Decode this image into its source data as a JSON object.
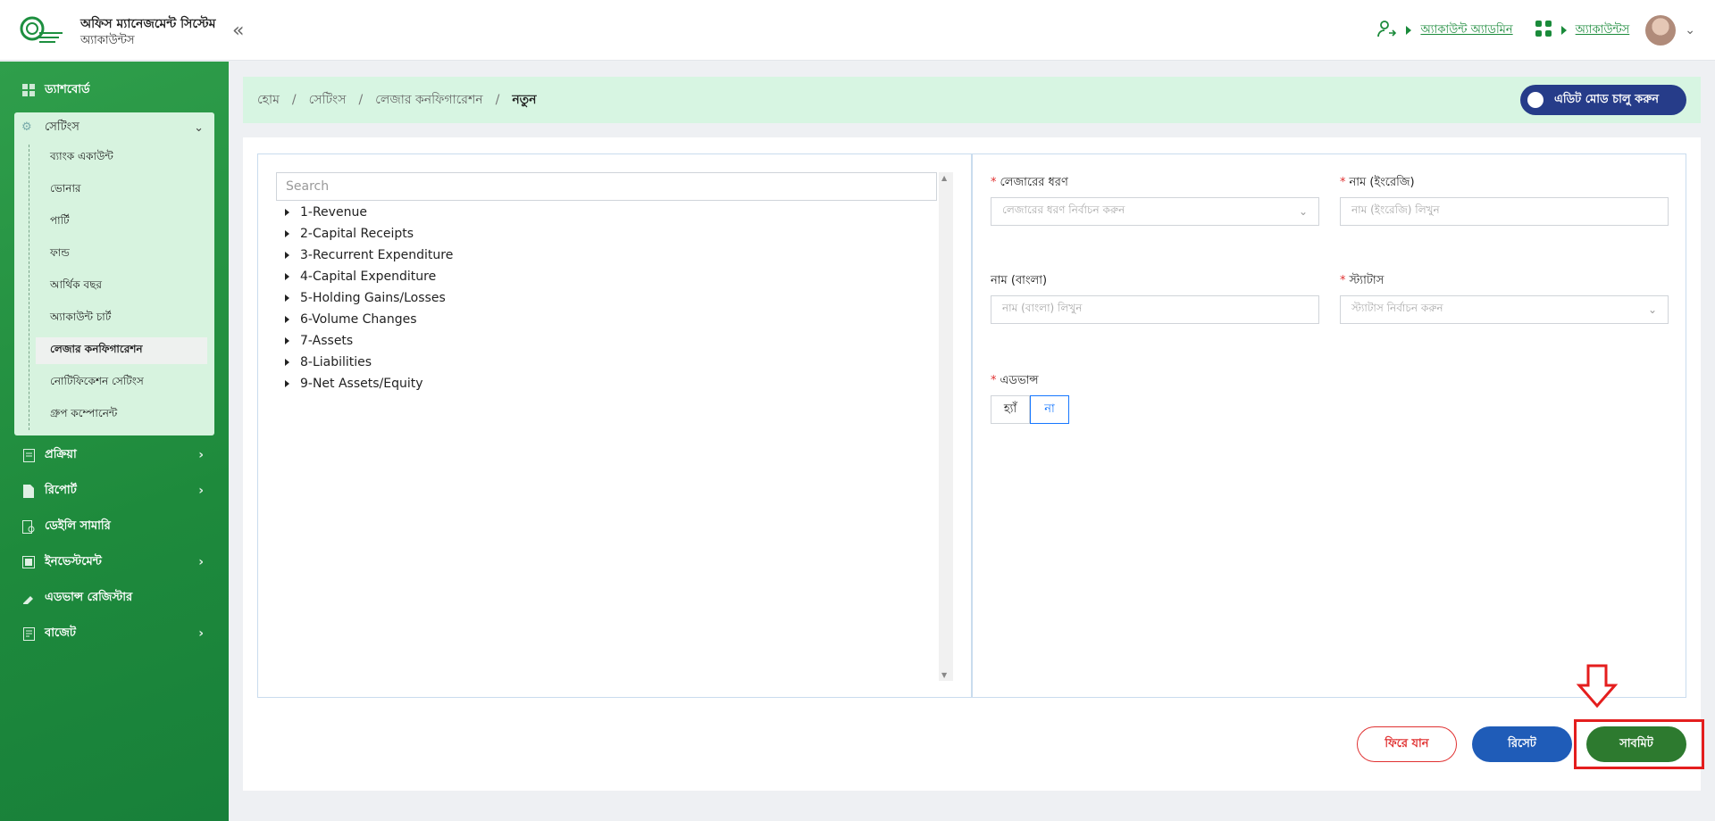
{
  "header": {
    "app_title": "অফিস ম্যানেজমেন্ট সিস্টেম",
    "app_subtitle": "অ্যাকাউন্টস",
    "collapse_icon": "«",
    "admin_link": "অ্যাকাউন্ট অ্যাডমিন",
    "module_link": "অ্যাকাউন্টস",
    "accent_color": "#1a8a3a"
  },
  "sidebar": {
    "dashboard": "ড্যাশবোর্ড",
    "settings": "সেটিংস",
    "settings_items": [
      {
        "label": "ব্যাংক একাউন্ট"
      },
      {
        "label": "ভোনার"
      },
      {
        "label": "পার্টি"
      },
      {
        "label": "ফান্ড"
      },
      {
        "label": "আর্থিক বছর"
      },
      {
        "label": "অ্যাকাউন্ট চার্ট"
      },
      {
        "label": "লেজার কনফিগারেশন"
      },
      {
        "label": "নোটিফিকেশন সেটিংস"
      },
      {
        "label": "গ্রুপ কম্পোনেন্ট"
      }
    ],
    "process": "প্রক্রিয়া",
    "report": "রিপোর্ট",
    "daily_summary": "ডেইলি সামারি",
    "investment": "ইনভেস্টমেন্ট",
    "advance_register": "এডভান্স রেজিস্টার",
    "budget": "বাজেট"
  },
  "breadcrumb": {
    "items": [
      "হোম",
      "সেটিংস",
      "লেজার কনফিগারেশন",
      "নতুন"
    ]
  },
  "edit_mode_label": "এডিট মোড চালু করুন",
  "tree": {
    "search_placeholder": "Search",
    "nodes": [
      {
        "label": "1-Revenue"
      },
      {
        "label": "2-Capital Receipts"
      },
      {
        "label": "3-Recurrent Expenditure"
      },
      {
        "label": "4-Capital Expenditure"
      },
      {
        "label": "5-Holding Gains/Losses"
      },
      {
        "label": "6-Volume Changes"
      },
      {
        "label": "7-Assets"
      },
      {
        "label": "8-Liabilities"
      },
      {
        "label": "9-Net Assets/Equity"
      }
    ]
  },
  "form": {
    "ledger_type_label": "লেজারের ধরণ",
    "ledger_type_placeholder": "লেজারের ধরণ নির্বাচন করুন",
    "name_en_label": "নাম (ইংরেজি)",
    "name_en_placeholder": "নাম (ইংরেজি) লিখুন",
    "name_bn_label": "নাম (বাংলা)",
    "name_bn_placeholder": "নাম (বাংলা) লিখুন",
    "status_label": "স্ট্যাটাস",
    "status_placeholder": "স্ট্যাটাস নির্বাচন করুন",
    "advance_label": "এডভান্স",
    "advance_yes": "হ্যাঁ",
    "advance_no": "না",
    "advance_selected": "না"
  },
  "actions": {
    "back": "ফিরে যান",
    "reset": "রিসেট",
    "submit": "সাবমিট"
  }
}
